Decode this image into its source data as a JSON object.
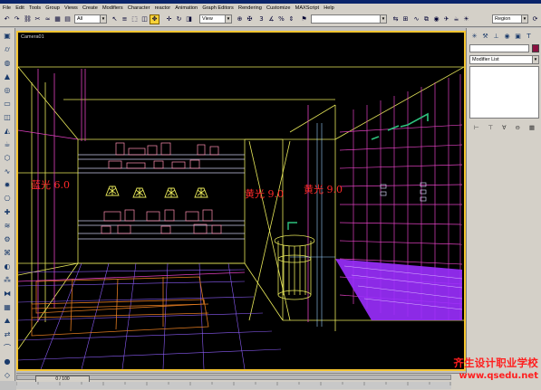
{
  "menu": {
    "items": [
      "File",
      "Edit",
      "Tools",
      "Group",
      "Views",
      "Create",
      "Modifiers",
      "Character",
      "reactor",
      "Animation",
      "Graph Editors",
      "Rendering",
      "Customize",
      "MAXScript",
      "Help"
    ]
  },
  "toolbar": {
    "selection_filter": "All",
    "reference_coord": "View",
    "named_selection": "",
    "region_mode": "Region"
  },
  "viewport": {
    "label": "Camera01",
    "light_tags": {
      "left": "蓝光 6.0",
      "middle": "黄光 9.0",
      "right": "黄光 9.0"
    }
  },
  "command_panel": {
    "modifier_list": "Modifier List"
  },
  "timeline": {
    "frame_label": "0 / 100"
  },
  "watermark": {
    "school_name": "齐生设计职业学校",
    "url": "www.qsedu.net"
  },
  "colors": {
    "viewport_border": "#f4c430",
    "wire_yellow": "#e8e85a",
    "wire_magenta": "#e040c0",
    "wire_pink": "#ff8fb0",
    "wire_orange": "#e07a20",
    "wire_purple": "#9b2fff",
    "tag_red": "#ff2a2a"
  }
}
